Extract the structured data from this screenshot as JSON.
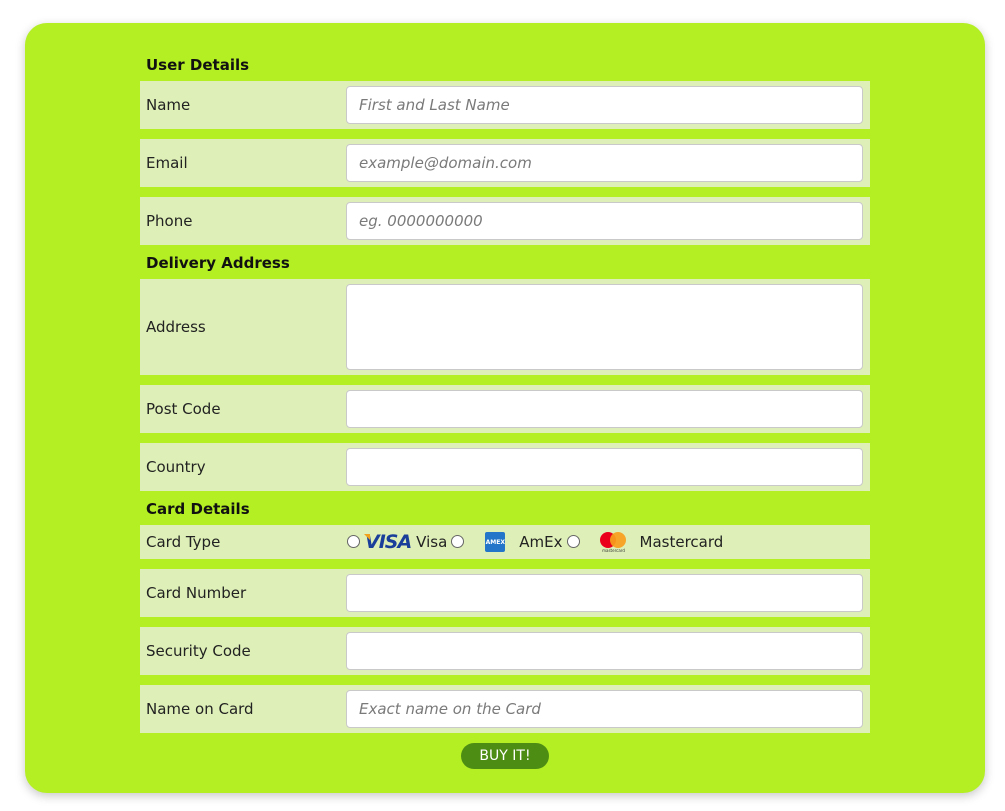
{
  "sections": {
    "user_details": "User Details",
    "delivery_address": "Delivery Address",
    "card_details": "Card Details"
  },
  "fields": {
    "name": {
      "label": "Name",
      "placeholder": "First and Last Name",
      "value": ""
    },
    "email": {
      "label": "Email",
      "placeholder": "example@domain.com",
      "value": ""
    },
    "phone": {
      "label": "Phone",
      "placeholder": "eg. 0000000000",
      "value": ""
    },
    "address": {
      "label": "Address",
      "placeholder": "",
      "value": ""
    },
    "post_code": {
      "label": "Post Code",
      "placeholder": "",
      "value": ""
    },
    "country": {
      "label": "Country",
      "placeholder": "",
      "value": ""
    },
    "card_type": {
      "label": "Card Type",
      "options": [
        {
          "label": "Visa",
          "logo_text": "VISA",
          "icon": "visa-logo-icon",
          "selected": false
        },
        {
          "label": "AmEx",
          "logo_text": "AMEX",
          "icon": "amex-logo-icon",
          "selected": false
        },
        {
          "label": "Mastercard",
          "logo_text": "mastercard",
          "icon": "mastercard-logo-icon",
          "selected": false
        }
      ]
    },
    "card_number": {
      "label": "Card Number",
      "placeholder": "",
      "value": ""
    },
    "security_code": {
      "label": "Security Code",
      "placeholder": "",
      "value": ""
    },
    "name_on_card": {
      "label": "Name on Card",
      "placeholder": "Exact name on the Card",
      "value": ""
    }
  },
  "submit": {
    "label": "BUY IT!"
  },
  "colors": {
    "panel_background": "#b3ef23",
    "row_background": "#def0b7",
    "button_background": "#4e8d14",
    "button_text": "#ffffff"
  }
}
